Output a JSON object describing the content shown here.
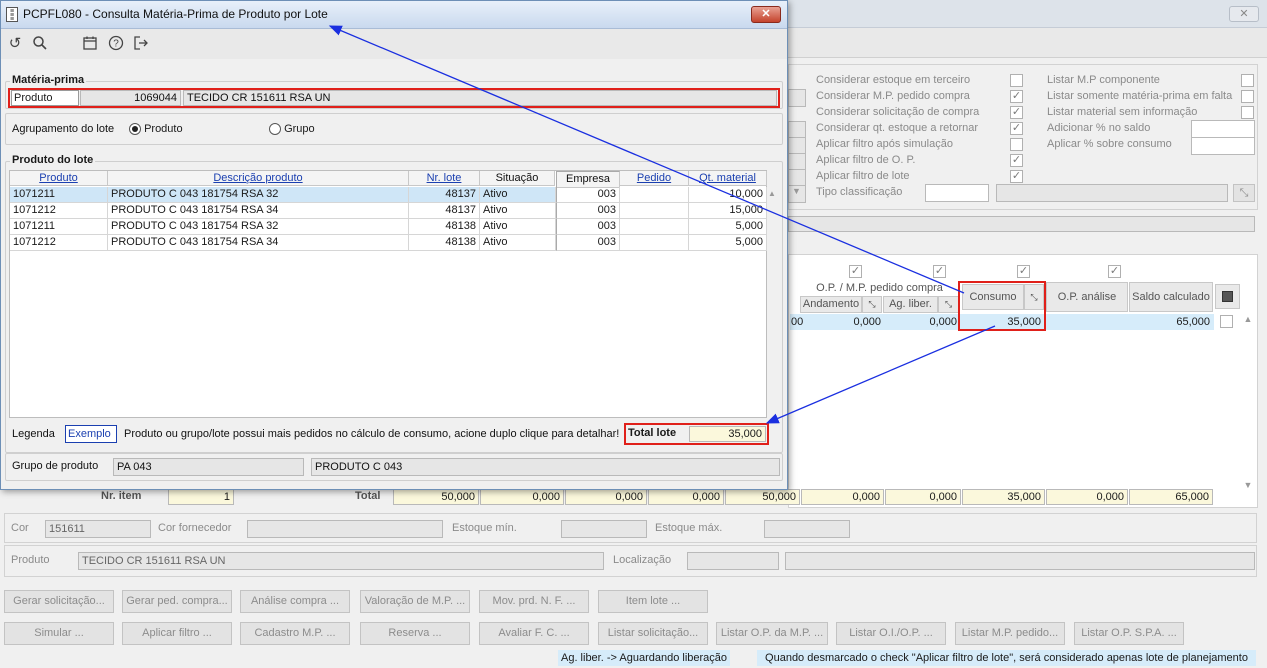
{
  "dialog": {
    "title": "PCPFL080 - Consulta Matéria-Prima de Produto por Lote",
    "close_glyph": "✕",
    "materia_prima": {
      "group_title": "Matéria-prima",
      "produto_label": "Produto",
      "produto_code": "1069044",
      "produto_desc": "TECIDO CR 151611 RSA UN"
    },
    "agrupamento": {
      "label": "Agrupamento do lote",
      "option_produto": "Produto",
      "option_grupo": "Grupo",
      "selected": "Produto"
    },
    "produto_lote": {
      "group_title": "Produto do lote",
      "columns": [
        "Produto",
        "Descrição produto",
        "Nr. lote",
        "Situação",
        "Empresa",
        "Pedido",
        "Qt. material"
      ],
      "rows": [
        [
          "1071211",
          "PRODUTO C 043 181754 RSA 32",
          "48137",
          "Ativo",
          "003",
          "",
          "10,000"
        ],
        [
          "1071212",
          "PRODUTO C 043 181754 RSA 34",
          "48137",
          "Ativo",
          "003",
          "",
          "15,000"
        ],
        [
          "1071211",
          "PRODUTO C 043 181754 RSA 32",
          "48138",
          "Ativo",
          "003",
          "",
          "5,000"
        ],
        [
          "1071212",
          "PRODUTO C 043 181754 RSA 34",
          "48138",
          "Ativo",
          "003",
          "",
          "5,000"
        ]
      ]
    },
    "legenda": {
      "label": "Legenda",
      "sample": "Exemplo",
      "text": "Produto ou grupo/lote possui mais pedidos no cálculo de consumo, acione duplo clique para detalhar!"
    },
    "total_lote": {
      "label": "Total lote",
      "value": "35,000"
    },
    "grupo_produto": {
      "label": "Grupo de produto",
      "code": "PA 043",
      "desc": "PRODUTO C 043"
    }
  },
  "main": {
    "options_left": [
      {
        "label": "Considerar estoque em terceiro",
        "checked": false
      },
      {
        "label": "Considerar M.P. pedido compra",
        "checked": true
      },
      {
        "label": "Considerar solicitação de compra",
        "checked": true
      },
      {
        "label": "Considerar qt. estoque a retornar",
        "checked": true
      },
      {
        "label": "Aplicar filtro após simulação",
        "checked": false
      },
      {
        "label": "Aplicar filtro de O. P.",
        "checked": true
      },
      {
        "label": "Aplicar filtro de lote",
        "checked": true
      }
    ],
    "options_right": [
      {
        "label": "Listar M.P componente",
        "checked": false
      },
      {
        "label": "Listar somente matéria-prima em falta",
        "checked": false
      },
      {
        "label": "Listar material sem informação",
        "checked": false
      }
    ],
    "adicionar_saldo_label": "Adicionar % no saldo",
    "aplicar_consumo_label": "Aplicar % sobre consumo",
    "tipo_classificacao_label": "Tipo classificação",
    "grid": {
      "group_header": "O.P. / M.P. pedido compra",
      "col_andamento": "Andamento",
      "col_ag_liber": "Ag. liber.",
      "col_consumo": "Consumo",
      "col_op_analise": "O.P. análise",
      "col_saldo": "Saldo calculado",
      "row": {
        "andamento": "0,000",
        "ag_liber": "0,000",
        "consumo": "35,000",
        "saldo": "65,000"
      }
    },
    "totals": {
      "nr_item_label": "Nr. item",
      "nr_item_value": "1",
      "total_label": "Total",
      "values": [
        "50,000",
        "0,000",
        "0,000",
        "0,000",
        "50,000",
        "0,000",
        "0,000",
        "35,000",
        "0,000",
        "65,000"
      ]
    },
    "cor_label": "Cor",
    "cor_value": "151611",
    "cor_fornecedor_label": "Cor fornecedor",
    "estoque_min_label": "Estoque mín.",
    "estoque_max_label": "Estoque máx.",
    "produto_label": "Produto",
    "produto_value": "TECIDO CR 151611 RSA UN",
    "localizacao_label": "Localização",
    "buttons_row1": [
      "Gerar solicitação...",
      "Gerar ped. compra...",
      "Análise compra ...",
      "Valoração de M.P. ...",
      "Mov. prd. N. F. ...",
      "Item lote ..."
    ],
    "buttons_row2": [
      "Simular ...",
      "Aplicar filtro ...",
      "Cadastro M.P. ...",
      "Reserva ...",
      "Avaliar F. C. ...",
      "Listar solicitação...",
      "Listar O.P. da M.P. ...",
      "Listar O.I./O.P. ...",
      "Listar M.P. pedido...",
      "Listar O.P. S.P.A. ..."
    ],
    "status_left": "Ag. liber. -> Aguardando liberação",
    "status_right": "Quando desmarcado o check \"Aplicar filtro de lote\", será considerado apenas lote de planejamento"
  },
  "colors": {
    "annotation_red": "#e0201a",
    "arrow_blue": "#1a2fe0",
    "selected_row": "#cfe6f7",
    "highlight_cell": "#d6ecfa"
  }
}
